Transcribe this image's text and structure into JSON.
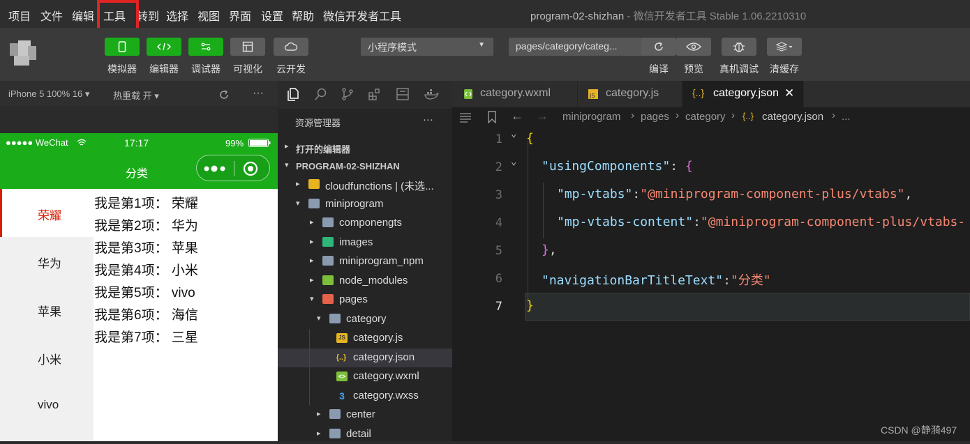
{
  "menu": {
    "items": [
      "项目",
      "文件",
      "编辑",
      "工具",
      "转到",
      "选择",
      "视图",
      "界面",
      "设置",
      "帮助",
      "微信开发者工具"
    ],
    "highlighted": "工具"
  },
  "window": {
    "title": "program-02-shizhan",
    "subtitle": " - 微信开发者工具 Stable 1.06.2210310"
  },
  "toolbar": {
    "left_buttons": [
      {
        "label": "模拟器",
        "icon": "phone-icon"
      },
      {
        "label": "编辑器",
        "icon": "code-icon"
      },
      {
        "label": "调试器",
        "icon": "debug-icon"
      },
      {
        "label": "可视化",
        "icon": "layout-icon"
      },
      {
        "label": "云开发",
        "icon": "cloud-icon"
      }
    ],
    "mode_select": "小程序模式",
    "page_select": "pages/category/categ...",
    "right_buttons": [
      {
        "label": "编译",
        "icon": "refresh-icon"
      },
      {
        "label": "预览",
        "icon": "eye-icon"
      },
      {
        "label": "真机调试",
        "icon": "bug-icon"
      },
      {
        "label": "清缓存",
        "icon": "layers-icon"
      }
    ]
  },
  "simulator": {
    "device": "iPhone 5 100% 16 ▾",
    "hot_reload": "热重载 开 ▾",
    "more": "···",
    "status": {
      "carrier": "●●●●● WeChat",
      "time": "17:17",
      "battery": "99%"
    },
    "nav_title": "分类",
    "tabs": [
      "荣耀",
      "华为",
      "苹果",
      "小米",
      "vivo"
    ],
    "active_tab": 0,
    "content": [
      "我是第1项： 荣耀",
      "我是第2项： 华为",
      "我是第3项： 苹果",
      "我是第4项： 小米",
      "我是第5项： vivo",
      "我是第6项： 海信",
      "我是第7项： 三星"
    ]
  },
  "explorer": {
    "title": "资源管理器",
    "more": "···",
    "open_editors": "打开的编辑器",
    "project": "PROGRAM-02-SHIZHAN",
    "tree": [
      {
        "label": "cloudfunctions | (未选...",
        "depth": 1,
        "arrow": "▸",
        "icon": "#e6b422"
      },
      {
        "label": "miniprogram",
        "depth": 1,
        "arrow": "▾",
        "icon": "#8a9bb0"
      },
      {
        "label": "componengts",
        "depth": 2,
        "arrow": "▸",
        "icon": "#8a9bb0"
      },
      {
        "label": "images",
        "depth": 2,
        "arrow": "▸",
        "icon": "#2fb67a"
      },
      {
        "label": "miniprogram_npm",
        "depth": 2,
        "arrow": "▸",
        "icon": "#8a9bb0"
      },
      {
        "label": "node_modules",
        "depth": 2,
        "arrow": "▸",
        "icon": "#7bbf3a"
      },
      {
        "label": "pages",
        "depth": 2,
        "arrow": "▾",
        "icon": "#e8624b"
      },
      {
        "label": "category",
        "depth": 3,
        "arrow": "▾",
        "icon": "#8a9bb0"
      },
      {
        "label": "category.js",
        "depth": 4,
        "arrow": "",
        "icon": "#e6b422",
        "glyph": "JS"
      },
      {
        "label": "category.json",
        "depth": 4,
        "arrow": "",
        "icon": "",
        "glyph": "{..}",
        "selected": true
      },
      {
        "label": "category.wxml",
        "depth": 4,
        "arrow": "",
        "icon": "#7bbf3a",
        "glyph": "<>"
      },
      {
        "label": "category.wxss",
        "depth": 4,
        "arrow": "",
        "icon": "",
        "glyph": "3"
      },
      {
        "label": "center",
        "depth": 3,
        "arrow": "▸",
        "icon": "#8a9bb0"
      },
      {
        "label": "detail",
        "depth": 3,
        "arrow": "▸",
        "icon": "#8a9bb0"
      }
    ]
  },
  "editor": {
    "tabs": [
      {
        "label": "category.wxml",
        "icon": "wxml-icon"
      },
      {
        "label": "category.js",
        "icon": "js-icon"
      },
      {
        "label": "category.json",
        "icon": "json-icon",
        "active": true
      }
    ],
    "close": "✕",
    "breadcrumb": [
      "miniprogram",
      "pages",
      "category",
      "category.json",
      "..."
    ],
    "line_numbers": [
      "1",
      "2",
      "3",
      "4",
      "5",
      "6",
      "7"
    ],
    "current_line": "7",
    "code": {
      "l1": "{",
      "l2_key": "\"usingComponents\"",
      "l2_rest": ": ",
      "l2_brace": "{",
      "l3_key": "\"mp-vtabs\"",
      "l3_colon": ":",
      "l3_val": "\"@miniprogram-component-plus/vtabs\"",
      "l3_end": ",",
      "l4_key": "\"mp-vtabs-content\"",
      "l4_colon": ":",
      "l4_val": "\"@miniprogram-component-plus/vtabs-",
      "l5_brace": "}",
      "l5_end": ",",
      "l6_key": "\"navigationBarTitleText\"",
      "l6_colon": ":",
      "l6_val": "\"分类\"",
      "l7": "}"
    }
  },
  "watermark": "CSDN @静漪497"
}
